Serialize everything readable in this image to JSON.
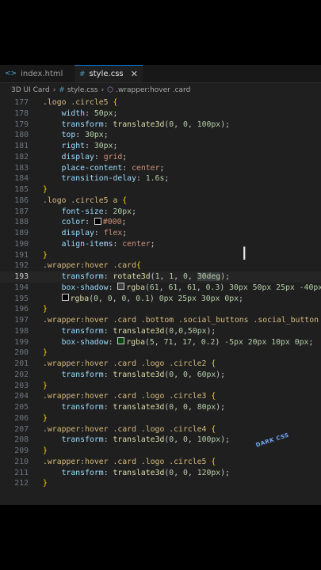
{
  "tabs": [
    {
      "icon": "<>",
      "label": "index.html",
      "active": false
    },
    {
      "icon": "#",
      "label": "style.css",
      "active": true,
      "close": "✕"
    }
  ],
  "breadcrumb": [
    "3D UI Card",
    "style.css",
    ".wrapper:hover .card"
  ],
  "watermark": "DARK CSS",
  "lines": [
    {
      "n": "177",
      "html": "<span class='sel'>.logo .circle5</span> <span class='brace'>{</span>"
    },
    {
      "n": "178",
      "html": "    <span class='prop'>width</span>: <span class='num2'>50px</span>;"
    },
    {
      "n": "179",
      "html": "    <span class='prop'>transform</span>: <span class='fn'>translate3d</span>(<span class='num2'>0</span>, <span class='num2'>0</span>, <span class='num2'>100px</span>);"
    },
    {
      "n": "180",
      "html": "    <span class='prop'>top</span>: <span class='num2'>30px</span>;"
    },
    {
      "n": "181",
      "html": "    <span class='prop'>right</span>: <span class='num2'>30px</span>;"
    },
    {
      "n": "182",
      "html": "    <span class='prop'>display</span>: <span class='val'>grid</span>;"
    },
    {
      "n": "183",
      "html": "    <span class='prop'>place-content</span>: <span class='val'>center</span>;"
    },
    {
      "n": "184",
      "html": "    <span class='prop'>transition-delay</span>: <span class='num2'>1.6s</span>;"
    },
    {
      "n": "185",
      "html": "<span class='brace'>}</span>"
    },
    {
      "n": "186",
      "html": "<span class='sel'>.logo .circle5 a</span> <span class='brace'>{</span>"
    },
    {
      "n": "187",
      "html": "    <span class='prop'>font-size</span>: <span class='num2'>20px</span>;"
    },
    {
      "n": "188",
      "html": "    <span class='prop'>color</span>: <span class='swatch' style='background:#000'></span><span class='val'>#000</span>;"
    },
    {
      "n": "189",
      "html": "    <span class='prop'>display</span>: <span class='val'>flex</span>;"
    },
    {
      "n": "190",
      "html": "    <span class='prop'>align-items</span>: <span class='val'>center</span>;"
    },
    {
      "n": "191",
      "html": "<span class='brace'>}</span>"
    },
    {
      "n": "192",
      "html": "<span class='sel'>.wrapper:hover .card</span><span class='brace'>{</span>"
    },
    {
      "n": "193",
      "current": true,
      "html": "    <span class='prop'>transform</span>: <span class='fn'>rotate3d</span>(<span class='num2'>1</span>, <span class='num2'>1</span>, <span class='num2'>0</span>, <span class='num2 hl'>30deg</span>);"
    },
    {
      "n": "194",
      "html": "    <span class='prop'>box-shadow</span>: <span class='swatch' style='background:#3d3d3d'></span><span class='fn'>rgba</span>(<span class='num2'>61</span>, <span class='num2'>61</span>, <span class='num2'>61</span>, <span class='num2'>0.3</span>) <span class='num2'>30px</span> <span class='num2'>50px</span> <span class='num2'>25px</span> <span class='num2'>-40px</span>,"
    },
    {
      "n": "195",
      "html": "    <span class='swatch' style='background:#000'></span><span class='fn'>rgba</span>(<span class='num2'>0</span>, <span class='num2'>0</span>, <span class='num2'>0</span>, <span class='num2'>0.1</span>) <span class='num2'>0px</span> <span class='num2'>25px</span> <span class='num2'>30px</span> <span class='num2'>0px</span>;"
    },
    {
      "n": "196",
      "html": "<span class='brace'>}</span>"
    },
    {
      "n": "197",
      "html": "<span class='sel'>.wrapper:hover .card .bottom .social_buttons .social_button</span> <span class='brace'>{</span>"
    },
    {
      "n": "198",
      "html": "    <span class='prop'>transform</span>: <span class='fn'>translate3d</span>(<span class='num2'>0</span>,<span class='num2'>0</span>,<span class='num2'>50px</span>);"
    },
    {
      "n": "199",
      "html": "    <span class='prop'>box-shadow</span>: <span class='swatch' style='background:#054711'></span><span class='fn'>rgba</span>(<span class='num2'>5</span>, <span class='num2'>71</span>, <span class='num2'>17</span>, <span class='num2'>0.2</span>) <span class='num2'>-5px</span> <span class='num2'>20px</span> <span class='num2'>10px</span> <span class='num2'>0px</span>;"
    },
    {
      "n": "200",
      "html": "<span class='brace'>}</span>"
    },
    {
      "n": "201",
      "html": "<span class='sel'>.wrapper:hover .card .logo .circle2</span> <span class='brace'>{</span>"
    },
    {
      "n": "202",
      "html": "    <span class='prop'>transform</span>: <span class='fn'>translate3d</span>(<span class='num2'>0</span>, <span class='num2'>0</span>, <span class='num2'>60px</span>);"
    },
    {
      "n": "203",
      "html": "<span class='brace'>}</span>"
    },
    {
      "n": "204",
      "html": "<span class='sel'>.wrapper:hover .card .logo .circle3</span> <span class='brace'>{</span>"
    },
    {
      "n": "205",
      "html": "    <span class='prop'>transform</span>: <span class='fn'>translate3d</span>(<span class='num2'>0</span>, <span class='num2'>0</span>, <span class='num2'>80px</span>);"
    },
    {
      "n": "206",
      "html": "<span class='brace'>}</span>"
    },
    {
      "n": "207",
      "html": "<span class='sel'>.wrapper:hover .card .logo .circle4</span> <span class='brace'>{</span>"
    },
    {
      "n": "208",
      "html": "    <span class='prop'>transform</span>: <span class='fn'>translate3d</span>(<span class='num2'>0</span>, <span class='num2'>0</span>, <span class='num2'>100px</span>);"
    },
    {
      "n": "209",
      "html": "<span class='brace'>}</span>"
    },
    {
      "n": "210",
      "html": "<span class='sel'>.wrapper:hover .card .logo .circle5</span> <span class='brace'>{</span>"
    },
    {
      "n": "211",
      "html": "    <span class='prop'>transform</span>: <span class='fn'>translate3d</span>(<span class='num2'>0</span>, <span class='num2'>0</span>, <span class='num2'>120px</span>);"
    },
    {
      "n": "212",
      "html": "<span class='brace'>}</span>"
    }
  ]
}
